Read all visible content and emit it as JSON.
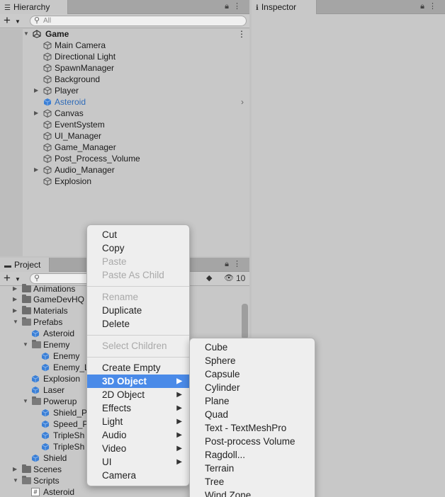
{
  "hierarchy": {
    "tab_title": "Hierarchy",
    "search_placeholder": "All",
    "scene": "Game",
    "items": [
      {
        "label": "Main Camera"
      },
      {
        "label": "Directional Light"
      },
      {
        "label": "SpawnManager"
      },
      {
        "label": "Background"
      },
      {
        "label": "Player"
      },
      {
        "label": "Asteroid"
      },
      {
        "label": "Canvas"
      },
      {
        "label": "EventSystem"
      },
      {
        "label": "UI_Manager"
      },
      {
        "label": "Game_Manager"
      },
      {
        "label": "Post_Process_Volume"
      },
      {
        "label": "Audio_Manager"
      },
      {
        "label": "Explosion"
      }
    ]
  },
  "inspector": {
    "tab_title": "Inspector"
  },
  "project": {
    "tab_title": "Project",
    "hidden_count": "10",
    "tree": [
      {
        "label": "Animations"
      },
      {
        "label": "GameDevHQ"
      },
      {
        "label": "Materials"
      },
      {
        "label": "Prefabs"
      },
      {
        "label": "Asteroid"
      },
      {
        "label": "Enemy"
      },
      {
        "label": "Enemy"
      },
      {
        "label": "Enemy_L"
      },
      {
        "label": "Explosion"
      },
      {
        "label": "Laser"
      },
      {
        "label": "Powerup"
      },
      {
        "label": "Shield_P"
      },
      {
        "label": "Speed_P"
      },
      {
        "label": "TripleSh"
      },
      {
        "label": "TripleSh"
      },
      {
        "label": "Shield"
      },
      {
        "label": "Scenes"
      },
      {
        "label": "Scripts"
      },
      {
        "label": "Asteroid"
      }
    ]
  },
  "context_menu": {
    "items": [
      {
        "label": "Cut"
      },
      {
        "label": "Copy"
      },
      {
        "label": "Paste"
      },
      {
        "label": "Paste As Child"
      },
      {
        "label": "Rename"
      },
      {
        "label": "Duplicate"
      },
      {
        "label": "Delete"
      },
      {
        "label": "Select Children"
      },
      {
        "label": "Create Empty"
      },
      {
        "label": "3D Object"
      },
      {
        "label": "2D Object"
      },
      {
        "label": "Effects"
      },
      {
        "label": "Light"
      },
      {
        "label": "Audio"
      },
      {
        "label": "Video"
      },
      {
        "label": "UI"
      },
      {
        "label": "Camera"
      }
    ]
  },
  "submenu": {
    "items": [
      {
        "label": "Cube"
      },
      {
        "label": "Sphere"
      },
      {
        "label": "Capsule"
      },
      {
        "label": "Cylinder"
      },
      {
        "label": "Plane"
      },
      {
        "label": "Quad"
      },
      {
        "label": "Text - TextMeshPro"
      },
      {
        "label": "Post-process Volume"
      },
      {
        "label": "Ragdoll..."
      },
      {
        "label": "Terrain"
      },
      {
        "label": "Tree"
      },
      {
        "label": "Wind Zone"
      }
    ]
  },
  "colors": {
    "selection": "#4a8ae8",
    "selected_text": "#2f6bb8",
    "prefab_blue": "#3a7fd6"
  },
  "icons": [
    "list-icon",
    "lock-icon",
    "kebab-icon",
    "info-icon",
    "folder-icon",
    "search-icon",
    "cube-icon",
    "prefab-icon",
    "script-icon",
    "unity-logo-icon",
    "eye-hidden-icon",
    "tag-icon",
    "submenu-arrow-icon"
  ]
}
